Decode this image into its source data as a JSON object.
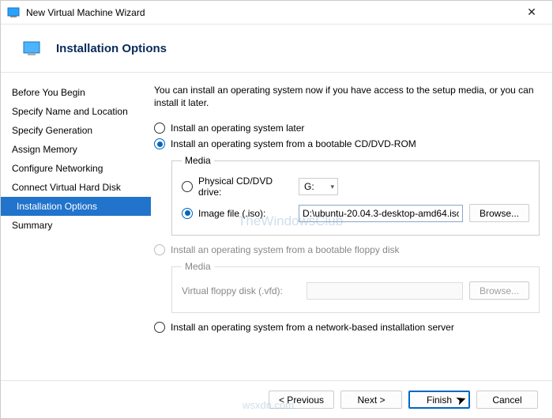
{
  "window": {
    "title": "New Virtual Machine Wizard"
  },
  "header": {
    "title": "Installation Options"
  },
  "sidebar": {
    "items": [
      {
        "label": "Before You Begin"
      },
      {
        "label": "Specify Name and Location"
      },
      {
        "label": "Specify Generation"
      },
      {
        "label": "Assign Memory"
      },
      {
        "label": "Configure Networking"
      },
      {
        "label": "Connect Virtual Hard Disk"
      },
      {
        "label": "Installation Options"
      },
      {
        "label": "Summary"
      }
    ]
  },
  "content": {
    "description": "You can install an operating system now if you have access to the setup media, or you can install it later.",
    "opt_later": "Install an operating system later",
    "opt_cdrom": "Install an operating system from a bootable CD/DVD-ROM",
    "opt_floppy": "Install an operating system from a bootable floppy disk",
    "opt_network": "Install an operating system from a network-based installation server",
    "media_legend": "Media",
    "physical_label": "Physical CD/DVD drive:",
    "physical_value": "G:",
    "image_label": "Image file (.iso):",
    "image_value": "D:\\ubuntu-20.04.3-desktop-amd64.iso",
    "browse_label": "Browse...",
    "vfd_label": "Virtual floppy disk (.vfd):"
  },
  "footer": {
    "previous": "< Previous",
    "next": "Next >",
    "finish": "Finish",
    "cancel": "Cancel"
  },
  "watermark": {
    "a": "TheWindowsClub",
    "b": "wsxdn.com"
  }
}
